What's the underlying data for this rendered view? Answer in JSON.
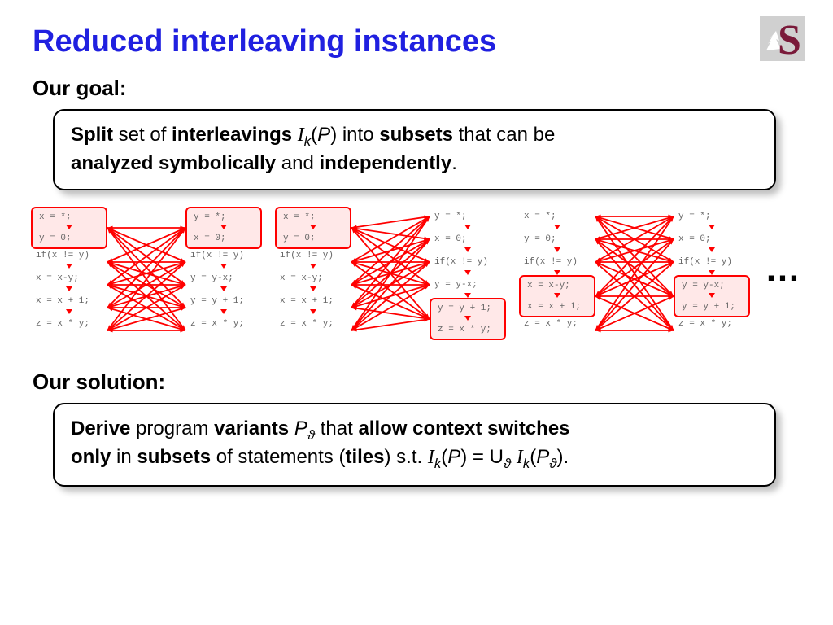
{
  "title": "Reduced interleaving instances",
  "goal_heading": "Our goal:",
  "goal_box": {
    "p1a": "Split",
    "p1b": " set of ",
    "p1c": "interleavings",
    "p1d": " ",
    "sym_I": "I",
    "sub_k": "k",
    "p1e": "(",
    "sym_P": "P",
    "p1f": ") into ",
    "p1g": "subsets",
    "p1h": " that can be ",
    "p2a": "analyzed symbolically",
    "p2b": " and ",
    "p2c": "independently",
    "p2d": "."
  },
  "solution_heading": "Our solution:",
  "solution_box": {
    "p1a": "Derive",
    "p1b": " program ",
    "p1c": "variants",
    "p1d": " ",
    "sym_P": "P",
    "sub_th": "ϑ",
    "p1e": " that ",
    "p1f": "allow context switches",
    "p2a": "only",
    "p2b": " in ",
    "p2c": "subsets",
    "p2d": " of statements (",
    "p2e": "tiles",
    "p2f": ") s.t. ",
    "sym_I": "I",
    "sub_k": "k",
    "p2g": "(",
    "p2h": ") = U",
    "p2i": " ",
    "p2j": "(",
    "p2k": ")."
  },
  "dots": "…",
  "stmts_left": [
    "x = *;",
    "y = 0;",
    "if(x != y)",
    "x = x-y;",
    "x = x + 1;",
    "z = x * y;"
  ],
  "stmts_right": [
    "y = *;",
    "x = 0;",
    "if(x != y)",
    "y = y-x;",
    "y = y + 1;",
    "z = x * y;"
  ],
  "diagrams": [
    {
      "tile_left": [
        0,
        1
      ],
      "tile_right": [
        0,
        1
      ]
    },
    {
      "tile_left": [
        0,
        1
      ],
      "tile_right": [
        4,
        5
      ]
    },
    {
      "tile_left": [
        3,
        4
      ],
      "tile_right": [
        3,
        4
      ]
    }
  ]
}
